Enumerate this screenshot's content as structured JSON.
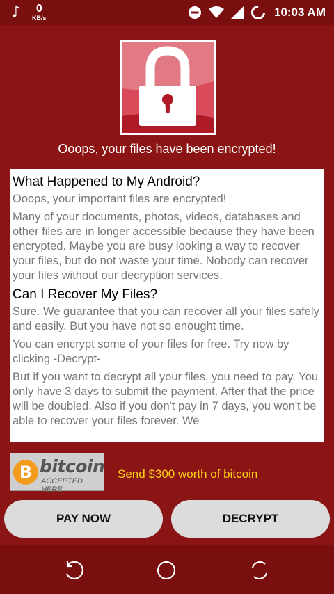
{
  "status_bar": {
    "music_icon": "music-note-icon",
    "net_speed_value": "0",
    "net_speed_unit": "KB/s",
    "time": "10:03 AM"
  },
  "header": {
    "lock_icon": "padlock-icon",
    "headline": "Ooops, your files have been encrypted!"
  },
  "message": {
    "sections": [
      {
        "heading": "What Happened to My Android?",
        "paragraphs": [
          "Ooops, your important files are encrypted!",
          "Many of your documents, photos, videos, databases and other files are in longer accessible because they have been encrypted. Maybe you are busy looking a way to recover your files, but do not waste your time. Nobody can recover your files without our decryption services."
        ]
      },
      {
        "heading": "Can I Recover My Files?",
        "paragraphs": [
          "Sure. We guarantee that you can recover all your files safely and easily. But you have not so enought time.",
          "You can encrypt some of your files for free. Try now by clicking -Decrypt-",
          "But if you want to decrypt all your files, you need to pay. You only have 3 days to submit the payment. After that the price will be doubled. Also if you don't pay in 7 days, you won't be able to recover your files forever. We"
        ]
      }
    ]
  },
  "payment": {
    "badge_word": "bitcoin",
    "badge_subtitle": "ACCEPTED HERE",
    "badge_symbol": "B",
    "send_text": "Send $300 worth of bitcoin"
  },
  "buttons": {
    "pay_now": "PAY NOW",
    "decrypt": "DECRYPT"
  },
  "colors": {
    "background": "#8b1414",
    "bars": "#7a0f0f",
    "send_text": "#ffd21a",
    "button": "#dcdcdc",
    "bitcoin_orange": "#f29b1c"
  }
}
